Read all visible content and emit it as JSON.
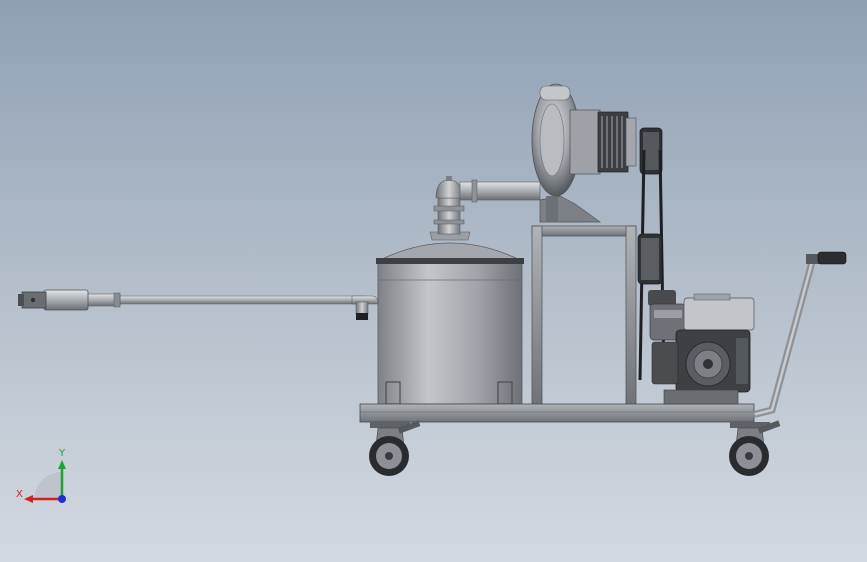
{
  "triad": {
    "x_label": "X",
    "y_label": "Y",
    "colors": {
      "x": "#d42020",
      "y": "#1fa32c",
      "z": "#1c2fd6"
    }
  },
  "palette": {
    "metal_light": "#c9cbcf",
    "metal_mid": "#9a9da3",
    "metal_dark": "#55585d",
    "frame": "#8d9096",
    "engine_dark": "#3a3c40",
    "tire": "#2a2b2e"
  }
}
